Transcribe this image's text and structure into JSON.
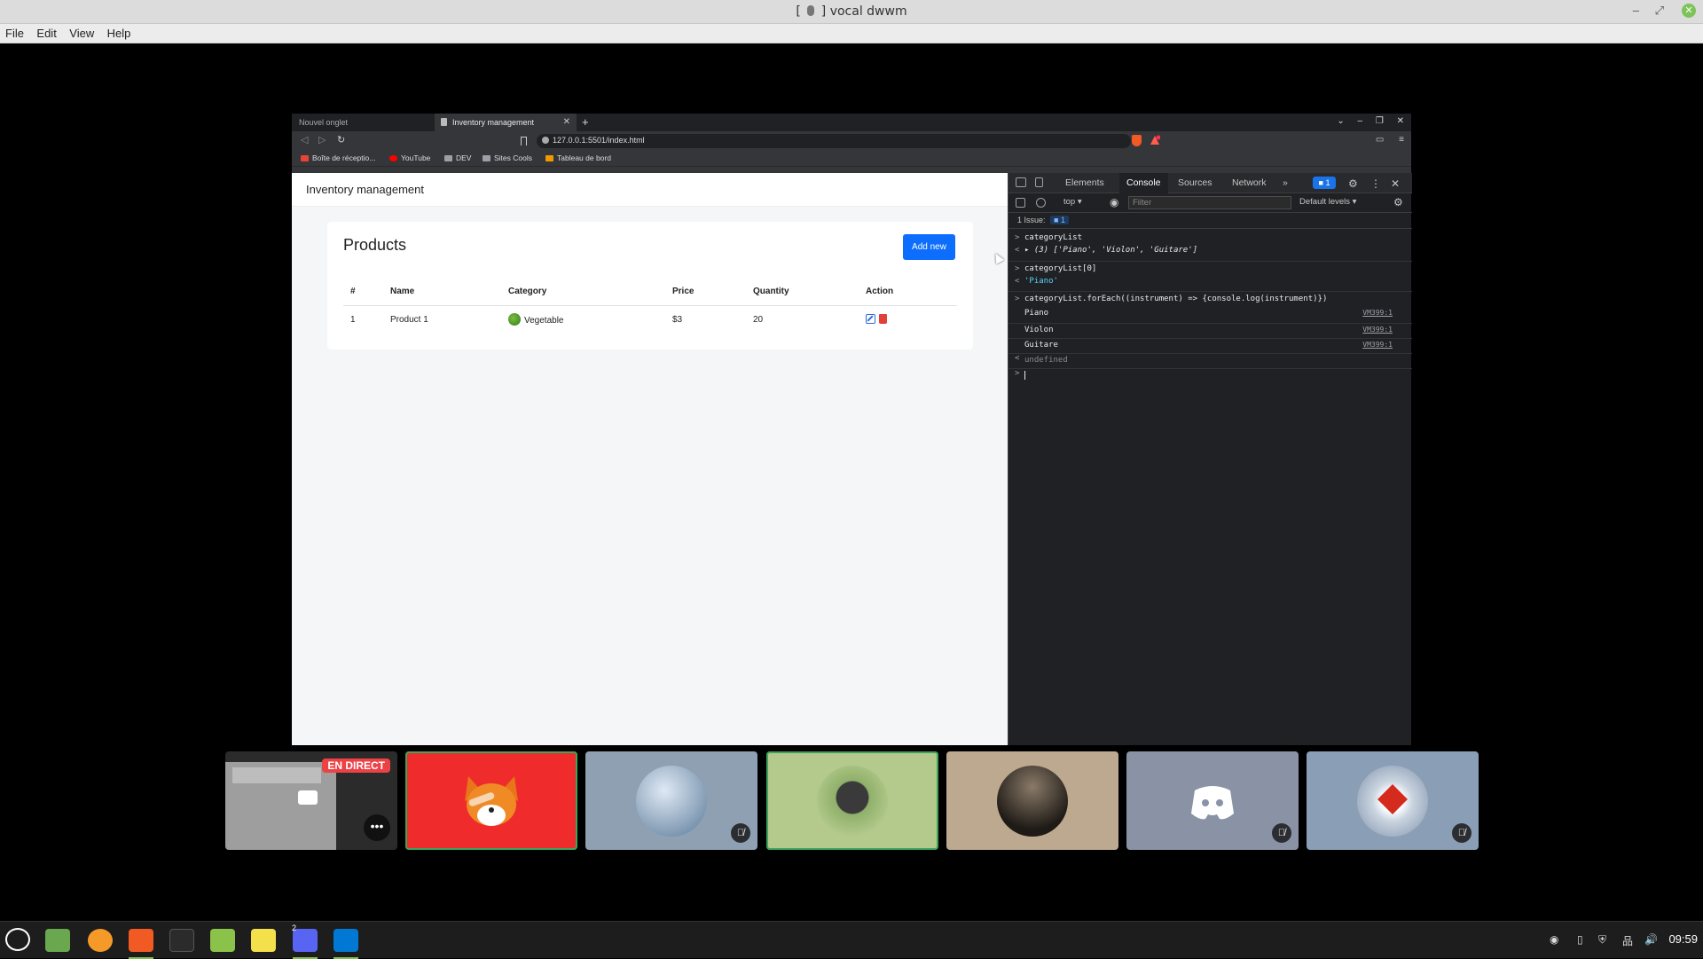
{
  "os": {
    "window_title": "vocal dwwm",
    "window_title_prefix": "[",
    "window_title_suffix": "]",
    "menu": [
      "File",
      "Edit",
      "View",
      "Help"
    ]
  },
  "browser": {
    "tabs": [
      {
        "label": "Nouvel onglet",
        "active": false
      },
      {
        "label": "Inventory management",
        "active": true
      }
    ],
    "url": "127.0.0.1:5501/index.html",
    "bookmarks": [
      {
        "label": "Boîte de réceptio...",
        "icon": "gmail-icon",
        "color": "#ea4335"
      },
      {
        "label": "YouTube",
        "icon": "youtube-icon",
        "color": "#ff0000"
      },
      {
        "label": "DEV",
        "icon": "folder-icon",
        "color": "#9aa0a6"
      },
      {
        "label": "Sites Cools",
        "icon": "folder-icon",
        "color": "#9aa0a6"
      },
      {
        "label": "Tableau de bord",
        "icon": "in-icon",
        "color": "#f29900"
      }
    ]
  },
  "page": {
    "brand": "Inventory management",
    "card_title": "Products",
    "add_button": "Add new",
    "columns": [
      "#",
      "Name",
      "Category",
      "Price",
      "Quantity",
      "Action"
    ],
    "rows": [
      {
        "index": "1",
        "name": "Product 1",
        "category": "Vegetable",
        "price": "$3",
        "quantity": "20"
      }
    ],
    "accent": "#0d6efd"
  },
  "devtools": {
    "tabs": [
      "Elements",
      "Console",
      "Sources",
      "Network"
    ],
    "more": "»",
    "issues_badge": "1",
    "context": "top ▾",
    "filter_placeholder": "Filter",
    "levels": "Default levels ▾",
    "issue_text": "1 Issue:",
    "issue_count": "1",
    "console": [
      {
        "prefix": ">",
        "text": "categoryList",
        "kind": "input"
      },
      {
        "prefix": "<",
        "text": "▸ (3) ['Piano', 'Violon', 'Guitare']",
        "kind": "result"
      },
      {
        "prefix": ">",
        "text": "categoryList[0]",
        "kind": "input"
      },
      {
        "prefix": "<",
        "text": "'Piano'",
        "kind": "str"
      },
      {
        "prefix": ">",
        "text": "categoryList.forEach((instrument) => {console.log(instrument)})",
        "kind": "input"
      },
      {
        "prefix": "",
        "text": "Piano",
        "kind": "log",
        "src": "VM399:1"
      },
      {
        "prefix": "",
        "text": "Violon",
        "kind": "log",
        "src": "VM399:1"
      },
      {
        "prefix": "",
        "text": "Guitare",
        "kind": "log",
        "src": "VM399:1"
      },
      {
        "prefix": "<",
        "text": "undefined",
        "kind": "muted"
      }
    ],
    "prompt": ">"
  },
  "call": {
    "live_label": "EN DIRECT",
    "more_label": "•••",
    "participants": [
      {
        "name": "stream",
        "bg": "#9e9e9e",
        "speaking": false
      },
      {
        "name": "fox",
        "bg": "#f02b2b",
        "speaking": true,
        "muted": false
      },
      {
        "name": "globe",
        "bg": "#8ea0b2",
        "speaking": false,
        "muted": true
      },
      {
        "name": "horse",
        "bg": "#b4c98c",
        "speaking": true,
        "muted": false
      },
      {
        "name": "silhouette",
        "bg": "#bda98f",
        "speaking": false,
        "muted": false
      },
      {
        "name": "discord-default",
        "bg": "#8a93a6",
        "speaking": false,
        "muted": true
      },
      {
        "name": "maple",
        "bg": "#8a9eb5",
        "speaking": false,
        "muted": true
      }
    ]
  },
  "taskbar": {
    "clock": "09:59",
    "discord_badge": "2"
  }
}
